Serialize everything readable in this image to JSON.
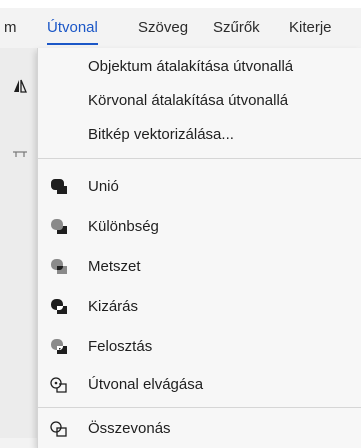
{
  "menubar": {
    "items": [
      {
        "label": "m",
        "active": false
      },
      {
        "label": "Útvonal",
        "active": true
      },
      {
        "label": "Szöveg",
        "active": false
      },
      {
        "label": "Szűrők",
        "active": false
      },
      {
        "label": "Kiterje",
        "active": false
      }
    ]
  },
  "path_menu": {
    "items": [
      {
        "label": "Objektum átalakítása útvonallá",
        "icon": "none"
      },
      {
        "label": "Körvonal átalakítása útvonallá",
        "icon": "none"
      },
      {
        "label": "Bitkép vektorizálása...",
        "icon": "none"
      },
      {
        "label": "Unió",
        "icon": "union-icon"
      },
      {
        "label": "Különbség",
        "icon": "difference-icon"
      },
      {
        "label": "Metszet",
        "icon": "intersection-icon"
      },
      {
        "label": "Kizárás",
        "icon": "exclusion-icon"
      },
      {
        "label": "Felosztás",
        "icon": "division-icon"
      },
      {
        "label": "Útvonal elvágása",
        "icon": "cut-path-icon"
      },
      {
        "label": "Összevonás",
        "icon": "combine-icon"
      }
    ]
  },
  "colors": {
    "accent": "#1b57c7",
    "menu_background": "#f7f7f7",
    "menubar_background": "#f3f3f3",
    "shape_dark": "#1e1e1e",
    "shape_gray": "#8a8a8a"
  }
}
